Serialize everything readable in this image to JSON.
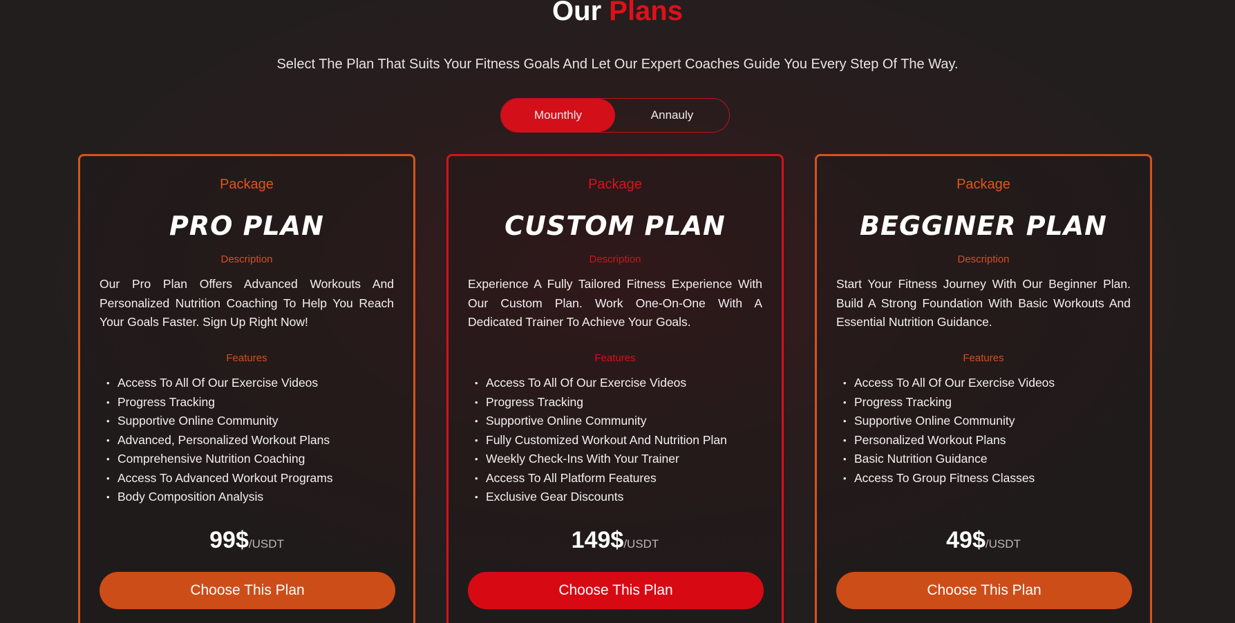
{
  "header": {
    "title_plain": "Our",
    "title_accent": "Plans",
    "subtitle": "Select The Plan That Suits Your Fitness Goals And Let Our Expert Coaches Guide You Every Step Of The Way."
  },
  "billing_toggle": {
    "monthly_label": "Mounthly",
    "annual_label": "Annauly",
    "selected": "monthly"
  },
  "colors": {
    "accent_red": "#d30f1a",
    "accent_orange": "#cd4d18",
    "background": "#221e1e"
  },
  "plans": [
    {
      "package_label": "Package",
      "name": "PRO PLAN",
      "description_label": "Description",
      "description": "Our Pro Plan Offers Advanced Workouts And Personalized Nutrition Coaching To Help You Reach Your Goals Faster. Sign Up Right Now!",
      "features_label": "Features",
      "features": [
        "Access To All Of Our Exercise Videos",
        "Progress Tracking",
        "Supportive Online Community",
        "Advanced, Personalized Workout Plans",
        "Comprehensive Nutrition Coaching",
        "Access To Advanced Workout Programs",
        "Body Composition Analysis"
      ],
      "price": "99$",
      "price_unit": "/USDT",
      "button_label": "Choose This Plan"
    },
    {
      "package_label": "Package",
      "name": "CUSTOM PLAN",
      "description_label": "Description",
      "description": "Experience A Fully Tailored Fitness Experience With Our Custom Plan. Work One-On-One With A Dedicated Trainer To Achieve Your Goals.",
      "features_label": "Features",
      "features": [
        "Access To All Of Our Exercise Videos",
        "Progress Tracking",
        "Supportive Online Community",
        "Fully Customized Workout And Nutrition Plan",
        "Weekly Check-Ins With Your Trainer",
        "Access To All Platform Features",
        "Exclusive Gear Discounts"
      ],
      "price": "149$",
      "price_unit": "/USDT",
      "button_label": "Choose This Plan"
    },
    {
      "package_label": "Package",
      "name": "BEGGINER PLAN",
      "description_label": "Description",
      "description": "Start Your Fitness Journey With Our Beginner Plan. Build A Strong Foundation With Basic Workouts And Essential Nutrition Guidance.",
      "features_label": "Features",
      "features": [
        "Access To All Of Our Exercise Videos",
        "Progress Tracking",
        "Supportive Online Community",
        "Personalized Workout Plans",
        "Basic Nutrition Guidance",
        "Access To Group Fitness Classes"
      ],
      "price": "49$",
      "price_unit": "/USDT",
      "button_label": "Choose This Plan"
    }
  ]
}
